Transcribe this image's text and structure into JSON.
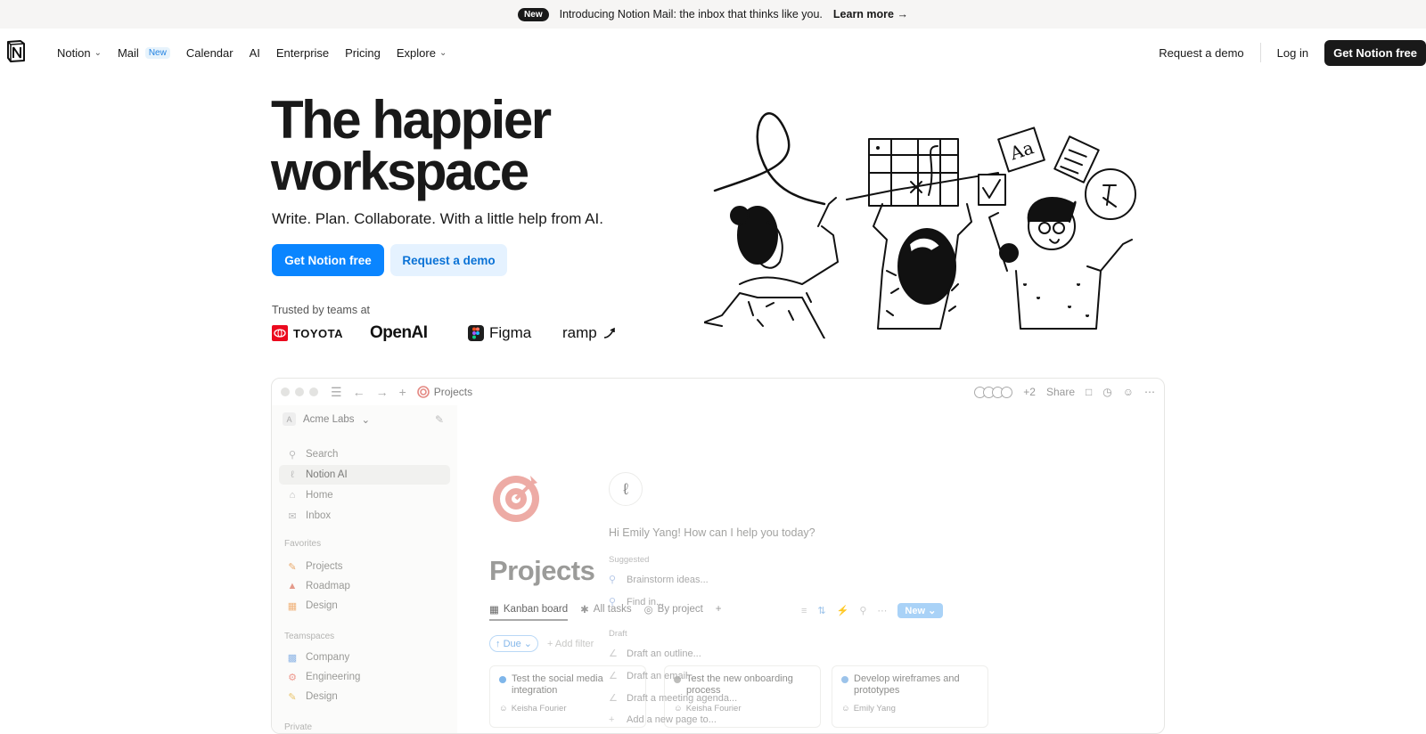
{
  "announcement": {
    "badge": "New",
    "text": "Introducing Notion Mail: the inbox that thinks like you.",
    "link": "Learn more →"
  },
  "nav": {
    "links": {
      "notion": "Notion",
      "mail": "Mail",
      "mail_badge": "New",
      "calendar": "Calendar",
      "ai": "AI",
      "enterprise": "Enterprise",
      "pricing": "Pricing",
      "explore": "Explore"
    },
    "request_demo": "Request a demo",
    "login": "Log in",
    "cta": "Get Notion free"
  },
  "hero": {
    "title_line1": "The happier",
    "title_line2": "workspace",
    "subtitle": "Write. Plan. Collaborate. With a little help from AI.",
    "primary_button": "Get Notion free",
    "secondary_button": "Request a demo",
    "trusted": "Trusted by teams at",
    "logos": [
      "TOYOTA",
      "OpenAI",
      "Figma",
      "ramp"
    ]
  },
  "app": {
    "breadcrumb": "Projects",
    "avatars_more": "+2",
    "share": "Share",
    "workspace": "Acme Labs",
    "workspace_initial": "A",
    "sidebar": {
      "search": "Search",
      "notion_ai": "Notion AI",
      "home": "Home",
      "inbox": "Inbox",
      "favorites_label": "Favorites",
      "favorites": [
        "Projects",
        "Roadmap",
        "Design"
      ],
      "teamspaces_label": "Teamspaces",
      "teamspaces": [
        "Company",
        "Engineering",
        "Design"
      ],
      "private_label": "Private"
    },
    "page_title": "Projects",
    "views": [
      "Kanban board",
      "All tasks",
      "By project"
    ],
    "new_button": "New",
    "filter_due": "Due",
    "add_filter": "+ Add filter",
    "cards": [
      {
        "title": "Test the social media integration",
        "owner": "Keisha Fourier",
        "dot": "#7fb6ea"
      },
      {
        "title": "Test the new onboarding process",
        "owner": "Keisha Fourier",
        "dot": "#bdbdbb"
      },
      {
        "title": "Develop wireframes and prototypes",
        "owner": "Emily Yang",
        "dot": "#9cc3ea"
      }
    ],
    "ai": {
      "greeting": "Hi Emily Yang! How can I help you today?",
      "suggested_label": "Suggested",
      "suggested": [
        "Brainstorm ideas...",
        "Find in..."
      ],
      "draft_label": "Draft",
      "draft": [
        "Draft an outline...",
        "Draft an email...",
        "Draft a meeting agenda..."
      ],
      "add_page": "Add a new page to..."
    }
  }
}
